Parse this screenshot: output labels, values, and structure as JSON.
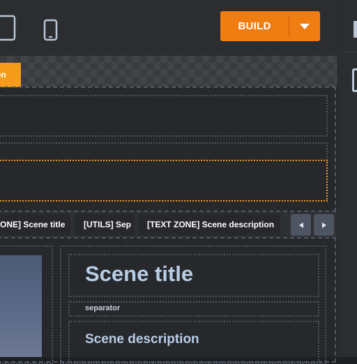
{
  "toolbar": {
    "build_label": "BUILD",
    "accent": "#f07d12"
  },
  "devices": [
    "tablet-icon",
    "phone-icon"
  ],
  "selected_tag": "on",
  "breadcrumbs": [
    {
      "type": "[...ONE]",
      "label": "Scene title"
    },
    {
      "type": "[UTILS]",
      "label": "Sep"
    },
    {
      "type": "[TEXT ZONE]",
      "label": "Scene description"
    }
  ],
  "scene": {
    "title": "Scene title",
    "separator": "separator",
    "description": "Scene description"
  }
}
